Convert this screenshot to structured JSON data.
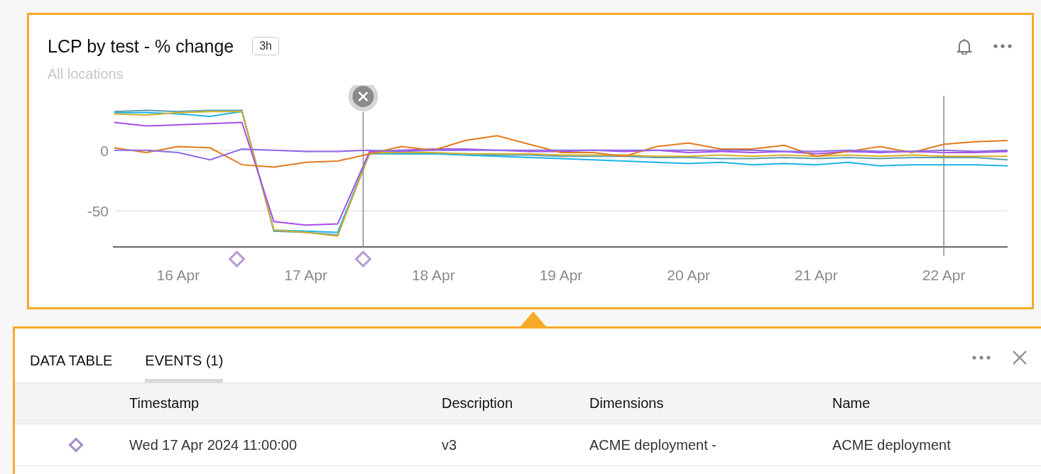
{
  "card": {
    "title": "LCP by test - % change",
    "badge": "3h",
    "subtitle": "All locations",
    "chart_data": {
      "type": "line",
      "categories": [
        null,
        null,
        "16 Apr",
        null,
        null,
        null,
        "17 Apr",
        null,
        null,
        null,
        "18 Apr",
        null,
        null,
        null,
        "19 Apr",
        null,
        null,
        null,
        "20 Apr",
        null,
        null,
        null,
        "21 Apr",
        null,
        null,
        null,
        "22 Apr",
        null,
        null
      ],
      "ylim": [
        -80,
        45
      ],
      "grid": true,
      "yticks": [
        {
          "value": 0,
          "label": "0"
        },
        {
          "value": -50,
          "label": "-50"
        }
      ],
      "series": [
        {
          "color": "#5a9fb5",
          "values": [
            32,
            33,
            32,
            33,
            33,
            -67,
            -68,
            -70,
            -3,
            -3,
            -3,
            -3,
            -4,
            -4,
            -5,
            -5,
            -5,
            -6,
            -6,
            -7,
            -7,
            -6,
            -7,
            -6,
            -7,
            -6,
            -6,
            -6,
            -8
          ]
        },
        {
          "color": "#1fb3e6",
          "values": [
            31,
            31,
            30,
            28,
            32,
            -66,
            -67,
            -68,
            -2,
            -3,
            -3,
            -4,
            -5,
            -6,
            -7,
            -8,
            -9,
            -10,
            -11,
            -10,
            -12,
            -11,
            -12,
            -10,
            -13,
            -12,
            -12,
            -12,
            -13
          ]
        },
        {
          "color": "#d4b02a",
          "values": [
            30,
            29,
            31,
            32,
            32,
            -66,
            -68,
            -71,
            -2,
            -2,
            -2,
            -3,
            -3,
            -3,
            -4,
            -4,
            -4,
            -5,
            -5,
            -4,
            -5,
            -4,
            -5,
            -4,
            -5,
            -4,
            -5,
            -5,
            -5
          ]
        },
        {
          "color": "#a64fe8",
          "values": [
            23,
            20,
            21,
            22,
            23,
            -59,
            -62,
            -61,
            -1,
            0,
            1,
            1,
            0,
            -1,
            -1,
            0,
            -1,
            0,
            -2,
            -1,
            -2,
            -1,
            -3,
            -1,
            -2,
            -1,
            -2,
            -2,
            -1
          ]
        },
        {
          "color": "#e37b1c",
          "values": [
            2,
            -2,
            3,
            2,
            -12,
            -14,
            -10,
            -9,
            -3,
            3,
            0,
            8,
            12,
            5,
            -2,
            -2,
            -5,
            3,
            6,
            1,
            1,
            4,
            -5,
            -1,
            3,
            -2,
            5,
            7,
            8
          ]
        },
        {
          "color": "#8c6be8",
          "values": [
            0,
            0,
            -2,
            -8,
            1,
            0,
            -1,
            -1,
            0,
            -1,
            0,
            0,
            0,
            0,
            0,
            0,
            0,
            0,
            0,
            0,
            0,
            -1,
            -1,
            0,
            -1,
            -1,
            0,
            -1,
            0
          ]
        }
      ]
    }
  },
  "panel": {
    "tabs": [
      {
        "label": "DATA TABLE",
        "selected": false
      },
      {
        "label": "EVENTS (1)",
        "selected": true
      }
    ],
    "table": {
      "columns": [
        "Timestamp",
        "Description",
        "Dimensions",
        "Name"
      ],
      "rows": [
        {
          "cells": [
            "Wed 17 Apr 2024 11:00:00",
            "v3",
            "ACME deployment -",
            "ACME deployment"
          ]
        }
      ]
    }
  }
}
